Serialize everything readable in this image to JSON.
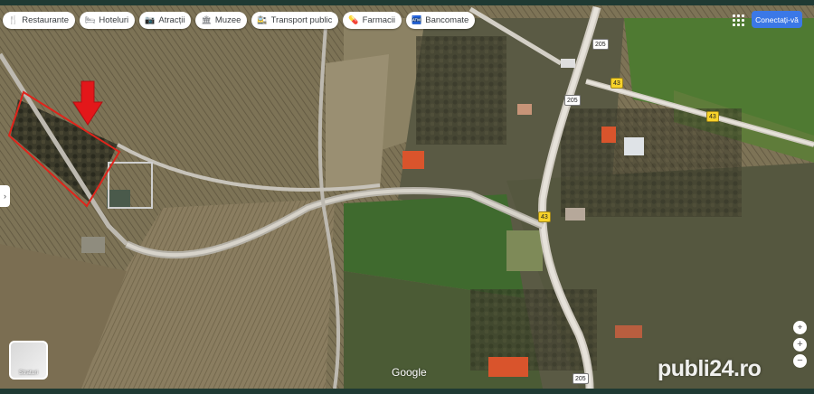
{
  "categories": [
    {
      "label": "Restaurante",
      "icon": "fork-knife-icon",
      "glyph": "🍴"
    },
    {
      "label": "Hoteluri",
      "icon": "bed-icon",
      "glyph": "🛏"
    },
    {
      "label": "Atracții",
      "icon": "camera-icon",
      "glyph": "📷"
    },
    {
      "label": "Muzee",
      "icon": "museum-icon",
      "glyph": "🏛"
    },
    {
      "label": "Transport public",
      "icon": "transit-icon",
      "glyph": "🚉"
    },
    {
      "label": "Farmacii",
      "icon": "pharmacy-icon",
      "glyph": "💊"
    },
    {
      "label": "Bancomate",
      "icon": "atm-icon",
      "glyph": "🏧"
    }
  ],
  "header": {
    "sign_in": "Conectați-vă"
  },
  "layers": {
    "label": "Straturi"
  },
  "map": {
    "attribution": "Google",
    "watermark": "publi24.ro",
    "road_labels": {
      "r205_top": "205",
      "r205_mid": "205",
      "r43_a": "43",
      "r43_b": "43",
      "r43_c": "43",
      "r205_bottom": "205"
    }
  },
  "controls": {
    "zoom_in": "+",
    "zoom_out": "−"
  },
  "colors": {
    "boundary": "#e0241b",
    "arrow": "#e3171a",
    "sign_in_bg": "#3b78e7"
  }
}
